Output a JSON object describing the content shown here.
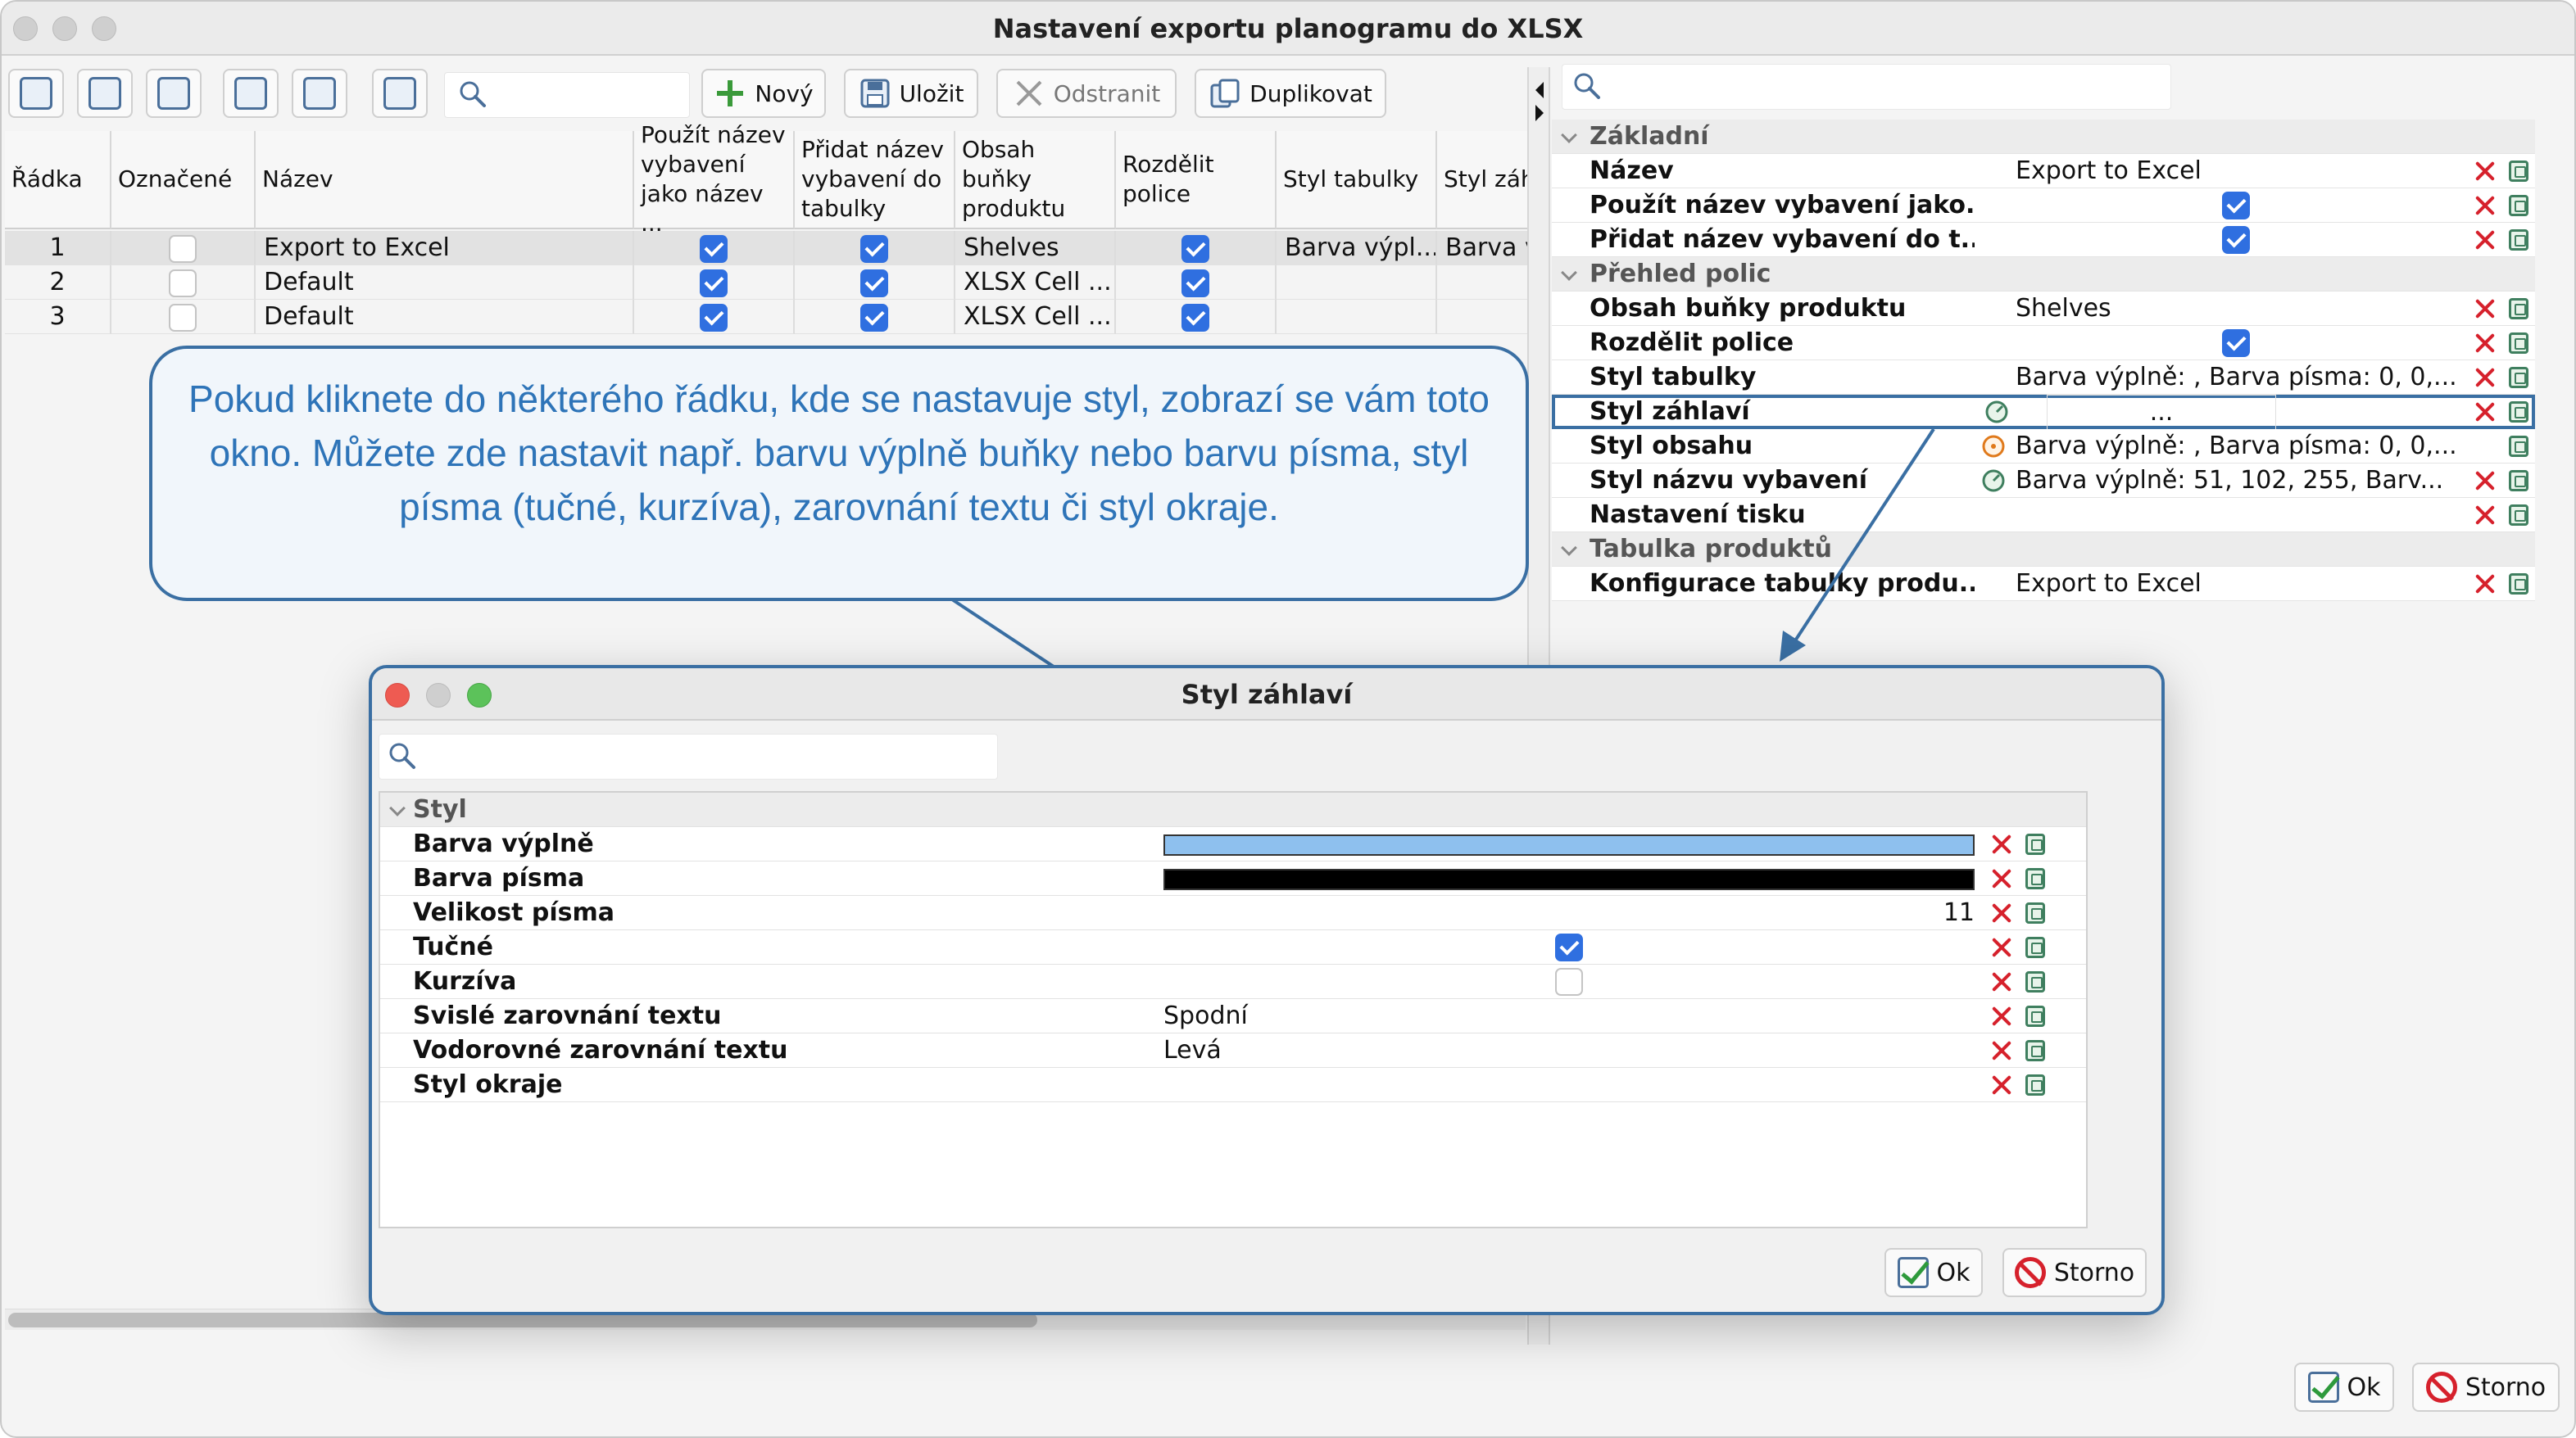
{
  "window": {
    "title": "Nastavení exportu planogramu do XLSX"
  },
  "toolbar": {
    "new_label": "Nový",
    "save_label": "Uložit",
    "delete_label": "Odstranit",
    "duplicate_label": "Duplikovat"
  },
  "grid": {
    "headers": [
      "Řádka",
      "Označené",
      "Název",
      "Použít název vybavení jako název ...",
      "Přidat název vybavení do tabulky",
      "Obsah buňky produktu",
      "Rozdělit police",
      "Styl tabulky",
      "Styl záh"
    ],
    "rows": [
      {
        "line": "1",
        "marked": false,
        "name": "Export to Excel",
        "use_name": true,
        "add_name": true,
        "content": "Shelves",
        "split": true,
        "table_style": "Barva výpl...",
        "header_style": "Barva v"
      },
      {
        "line": "2",
        "marked": false,
        "name": "Default",
        "use_name": true,
        "add_name": true,
        "content": "XLSX Cell ...",
        "split": true,
        "table_style": "",
        "header_style": ""
      },
      {
        "line": "3",
        "marked": false,
        "name": "Default",
        "use_name": true,
        "add_name": true,
        "content": "XLSX Cell ...",
        "split": true,
        "table_style": "",
        "header_style": ""
      }
    ]
  },
  "properties": {
    "groups": [
      {
        "label": "Základní",
        "rows": [
          {
            "key": "Název",
            "value": "Export to Excel"
          },
          {
            "key": "Použít název vybavení jako...",
            "check": true
          },
          {
            "key": "Přidat název vybavení do t...",
            "check": true
          }
        ]
      },
      {
        "label": "Přehled polic",
        "rows": [
          {
            "key": "Obsah buňky produktu",
            "value": "Shelves"
          },
          {
            "key": "Rozdělit police",
            "check": true
          },
          {
            "key": "Styl tabulky",
            "value": "Barva výplně: , Barva písma: 0, 0,..."
          },
          {
            "key": "Styl záhlaví",
            "value": "..."
          },
          {
            "key": "Styl obsahu",
            "value": "Barva výplně: , Barva písma: 0, 0,..."
          },
          {
            "key": "Styl názvu vybavení",
            "value": "Barva výplně: 51, 102, 255, Barv..."
          },
          {
            "key": "Nastavení tisku",
            "value": ""
          }
        ]
      },
      {
        "label": "Tabulka produktů",
        "rows": [
          {
            "key": "Konfigurace tabulky produ...",
            "value": "Export to Excel"
          }
        ]
      }
    ]
  },
  "callout": {
    "text": "Pokud kliknete do některého řádku, kde se nastavuje styl, zobrazí se vám toto okno. Můžete zde nastavit např. barvu výplně buňky nebo barvu písma, styl písma (tučné, kurzíva), zarovnání textu či styl okraje."
  },
  "dialog": {
    "title": "Styl záhlaví",
    "group": "Styl",
    "rows": [
      {
        "key": "Barva výplně",
        "type": "color",
        "color": "#8ec0ee"
      },
      {
        "key": "Barva písma",
        "type": "color",
        "color": "#000000"
      },
      {
        "key": "Velikost písma",
        "type": "number",
        "value": "11"
      },
      {
        "key": "Tučné",
        "type": "check",
        "checked": true
      },
      {
        "key": "Kurzíva",
        "type": "check",
        "checked": false
      },
      {
        "key": "Svislé zarovnání textu",
        "type": "text",
        "value": "Spodní"
      },
      {
        "key": "Vodorovné zarovnání textu",
        "type": "text",
        "value": "Levá"
      },
      {
        "key": "Styl okraje",
        "type": "text",
        "value": ""
      }
    ],
    "ok_label": "Ok",
    "cancel_label": "Storno"
  },
  "footer": {
    "ok_label": "Ok",
    "cancel_label": "Storno"
  },
  "colors": {
    "accent": "#2f6fe0",
    "callout_border": "#3a6fa3",
    "callout_text": "#2e74b8",
    "delete_red": "#d6212c"
  }
}
